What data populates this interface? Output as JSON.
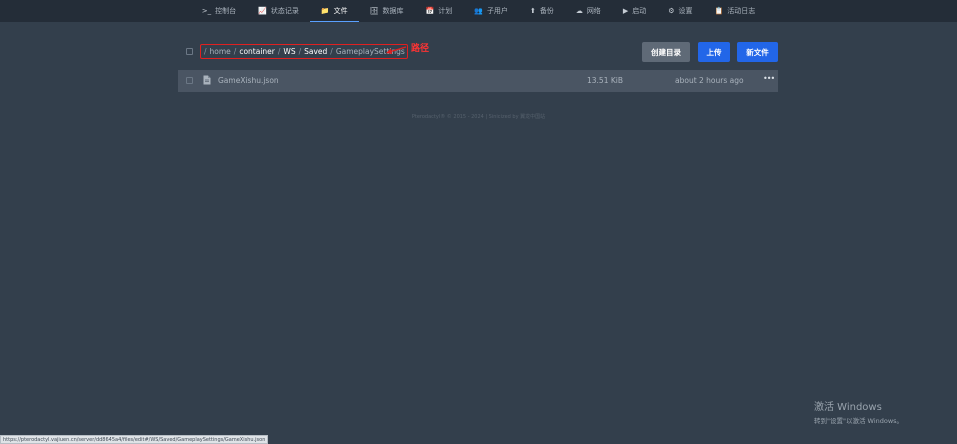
{
  "nav": {
    "items": [
      {
        "icon": ">_",
        "label": "控制台"
      },
      {
        "icon": "📈",
        "label": "状态记录"
      },
      {
        "icon": "📁",
        "label": "文件"
      },
      {
        "icon": "🗄",
        "label": "数据库"
      },
      {
        "icon": "📅",
        "label": "计划"
      },
      {
        "icon": "👥",
        "label": "子用户"
      },
      {
        "icon": "⬆",
        "label": "备份"
      },
      {
        "icon": "☁",
        "label": "网络"
      },
      {
        "icon": "▶",
        "label": "启动"
      },
      {
        "icon": "⚙",
        "label": "设置"
      },
      {
        "icon": "📋",
        "label": "活动日志"
      }
    ],
    "active_index": 2
  },
  "breadcrumb": {
    "separator": "/",
    "segments": [
      "home",
      "container",
      "WS",
      "Saved",
      "GameplaySettings"
    ]
  },
  "annotation": {
    "label": "路径"
  },
  "buttons": {
    "create_directory": "创建目录",
    "upload": "上传",
    "new_file": "新文件"
  },
  "files": [
    {
      "name": "GameXishu.json",
      "size": "13.51 KiB",
      "modified": "about 2 hours ago",
      "menu": "•••"
    }
  ],
  "footer": {
    "text": "Pterodactyl® © 2015 - 2024 | Sinicized by 翼龙中国站"
  },
  "windows_activation": {
    "title": "激活 Windows",
    "subtitle": "转到\"设置\"以激活 Windows。"
  },
  "status_url": "https://pterodactyl.vajiuen.cn/server/dd8645a4/files/edit#/WS/Saved/GameplaySettings/GameXishu.json",
  "colors": {
    "background": "#333f4c",
    "nav_background": "#242d38",
    "primary_button": "#2266e8",
    "secondary_button": "#5f6a77",
    "annotation": "#e02020"
  }
}
